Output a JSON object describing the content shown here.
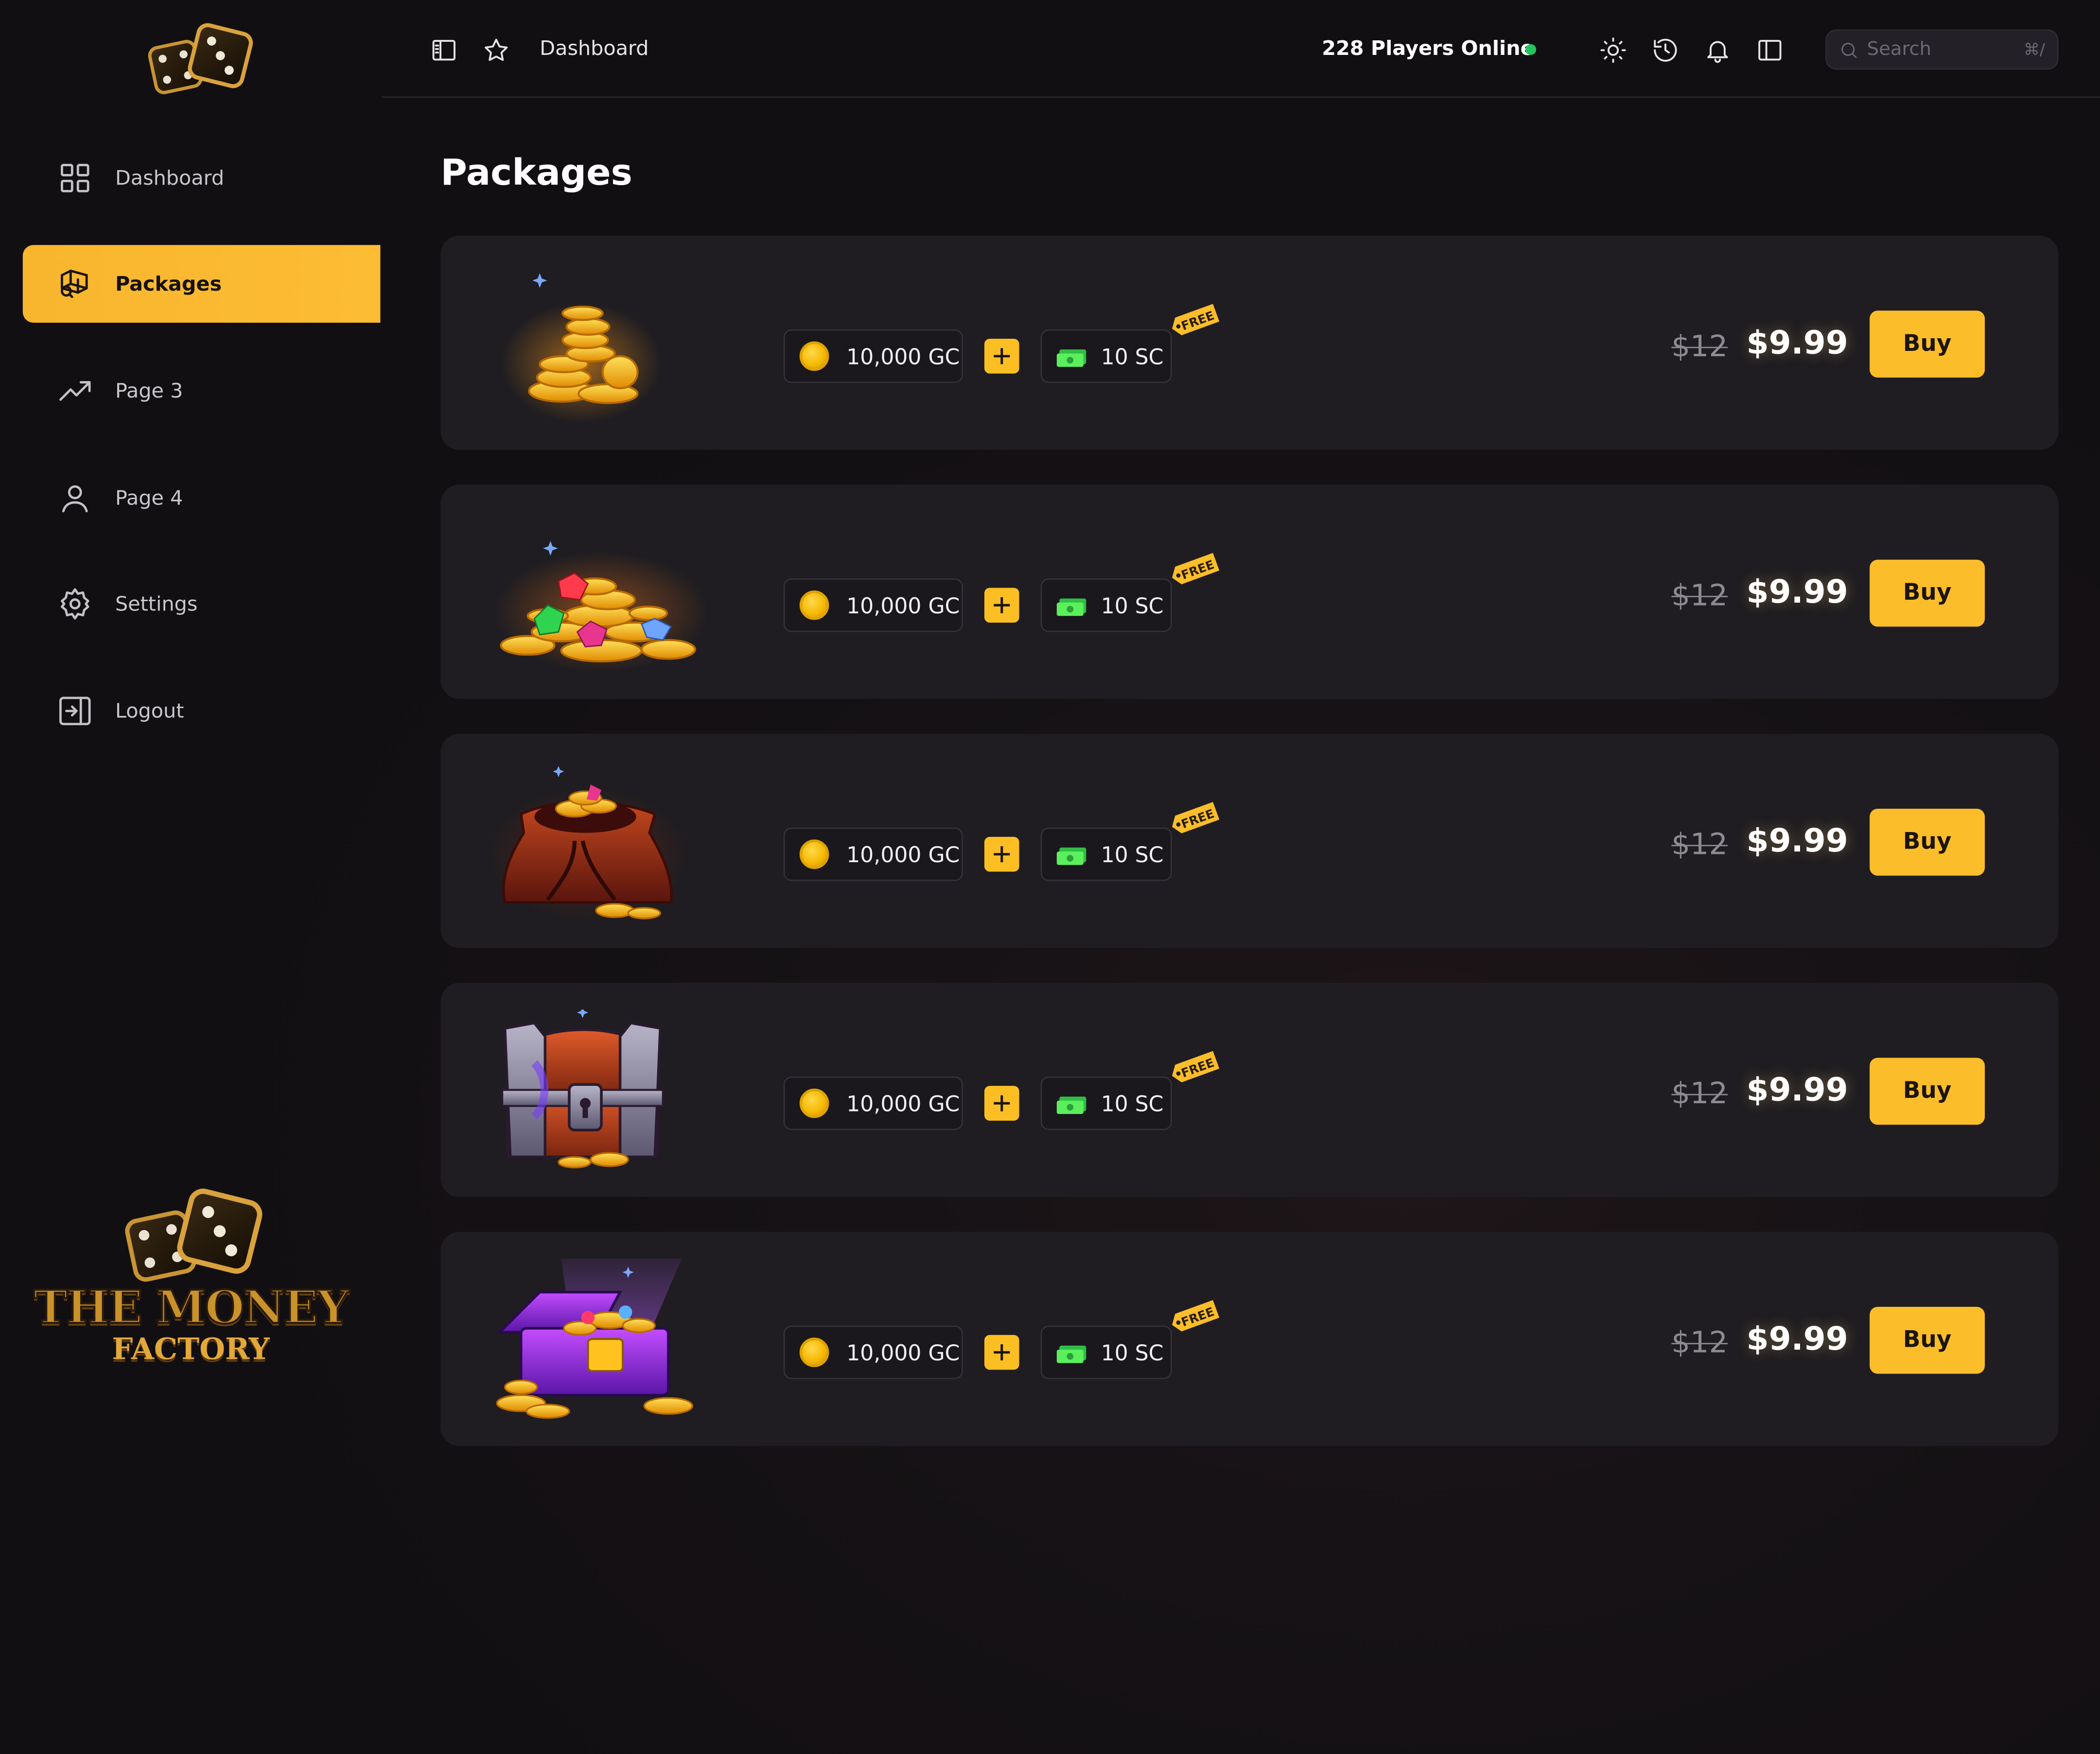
{
  "sidebar": {
    "items": [
      {
        "label": "Dashboard",
        "icon": "grid-icon"
      },
      {
        "label": "Packages",
        "icon": "package-icon"
      },
      {
        "label": "Page 3",
        "icon": "trending-up-icon"
      },
      {
        "label": "Page 4",
        "icon": "user-icon"
      },
      {
        "label": "Settings",
        "icon": "gear-icon"
      },
      {
        "label": "Logout",
        "icon": "logout-icon"
      }
    ],
    "active_index": 1,
    "brand": {
      "line1": "THE MONEY",
      "line2": "FACTORY"
    }
  },
  "topbar": {
    "breadcrumb": "Dashboard",
    "players_online": "228 Players Online",
    "status_color": "#22c55e",
    "search": {
      "placeholder": "Search",
      "shortcut": "⌘/"
    }
  },
  "main": {
    "title": "Packages",
    "packages": [
      {
        "art": "coin-stack",
        "gc": "10,000 GC",
        "sc": "10 SC",
        "tag": "FREE",
        "old_price": "$12",
        "price": "$9.99",
        "buy": "Buy"
      },
      {
        "art": "coins-and-gems",
        "gc": "10,000 GC",
        "sc": "10 SC",
        "tag": "FREE",
        "old_price": "$12",
        "price": "$9.99",
        "buy": "Buy"
      },
      {
        "art": "treasure-sack",
        "gc": "10,000 GC",
        "sc": "10 SC",
        "tag": "FREE",
        "old_price": "$12",
        "price": "$9.99",
        "buy": "Buy"
      },
      {
        "art": "iron-chest",
        "gc": "10,000 GC",
        "sc": "10 SC",
        "tag": "FREE",
        "old_price": "$12",
        "price": "$9.99",
        "buy": "Buy"
      },
      {
        "art": "magic-chest",
        "gc": "10,000 GC",
        "sc": "10 SC",
        "tag": "FREE",
        "old_price": "$12",
        "price": "$9.99",
        "buy": "Buy"
      }
    ]
  },
  "colors": {
    "accent": "#fbbd2a",
    "background": "#120f13",
    "card": "#1f1d21"
  }
}
